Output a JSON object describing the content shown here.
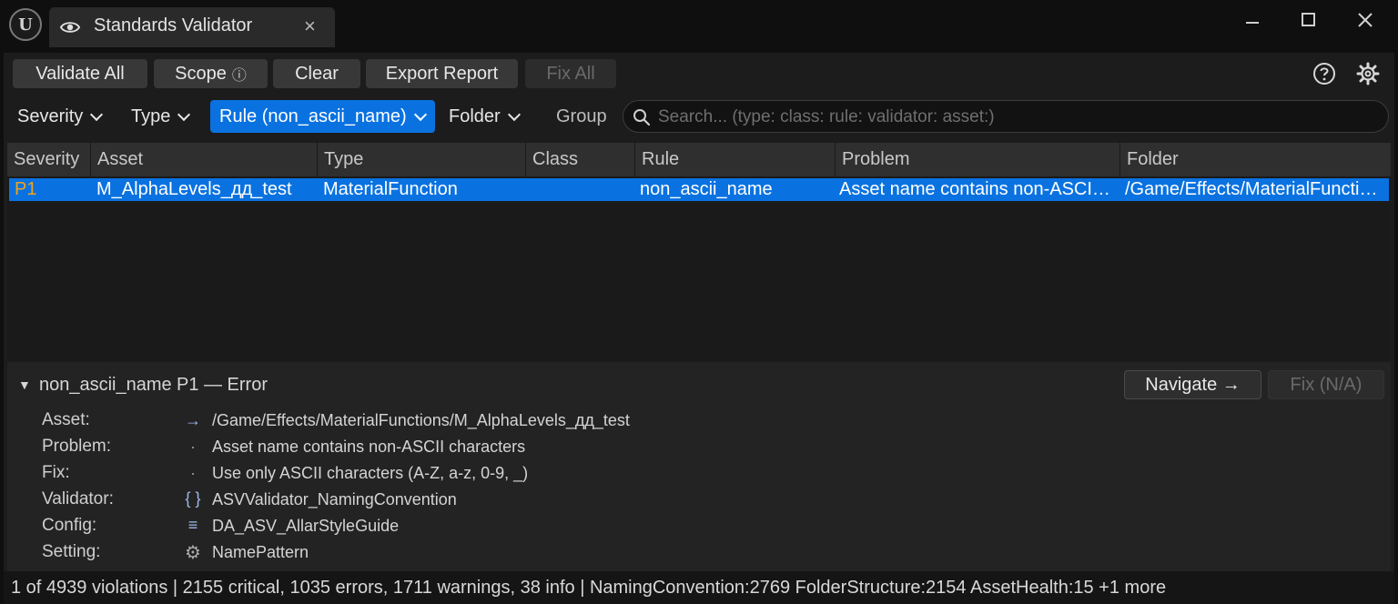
{
  "window": {
    "tab_title": "Standards Validator",
    "tab_close": "×",
    "minimize": "–",
    "maximize": "☐",
    "close": "✕",
    "logo_glyph": "U"
  },
  "toolbar": {
    "validate_all": "Validate All",
    "scope": "Scope",
    "scope_info": "ⓘ",
    "clear": "Clear",
    "export_report": "Export Report",
    "fix_all": "Fix All"
  },
  "filters": {
    "severity": "Severity",
    "type": "Type",
    "rule": "Rule (non_ascii_name)",
    "folder": "Folder",
    "group": "Group",
    "search_placeholder": "Search... (type: class: rule: validator: asset:)"
  },
  "table": {
    "columns": [
      "Severity",
      "Asset",
      "Type",
      "Class",
      "Rule",
      "Problem",
      "Folder"
    ],
    "rows": [
      {
        "severity": "P1",
        "asset": "M_AlphaLevels_дд_test",
        "type": "MaterialFunction",
        "class": "",
        "rule": "non_ascii_name",
        "problem": "Asset name contains non-ASCII characters",
        "folder": "/Game/Effects/MaterialFunctions"
      }
    ]
  },
  "details": {
    "toggle": "▼",
    "rule": "non_ascii_name",
    "severity": "P1",
    "level": "— Error",
    "navigate": "Navigate →",
    "fix": "Fix (N/A)",
    "fields": [
      {
        "label": "Asset:",
        "icon": "→",
        "value": "/Game/Effects/MaterialFunctions/M_AlphaLevels_дд_test"
      },
      {
        "label": "Problem:",
        "icon": "·",
        "value": "Asset name contains non-ASCII characters"
      },
      {
        "label": "Fix:",
        "icon": "·",
        "value": "Use only ASCII characters (A-Z, a-z, 0-9, _)"
      },
      {
        "label": "Validator:",
        "icon": "{ }",
        "value": "ASVValidator_NamingConvention"
      },
      {
        "label": "Config:",
        "icon": "≡",
        "value": "DA_ASV_AllarStyleGuide"
      },
      {
        "label": "Setting:",
        "icon": "⚙",
        "value": "NamePattern"
      }
    ]
  },
  "status": {
    "text": "1 of 4939 violations  |  2155 critical, 1035 errors, 1711 warnings, 38 info  |  NamingConvention:2769  FolderStructure:2154  AssetHealth:15  +1 more"
  },
  "colors": {
    "accent": "#0a72e0",
    "severity_p1": "#f2a21a",
    "background": "#1c1c1c"
  }
}
